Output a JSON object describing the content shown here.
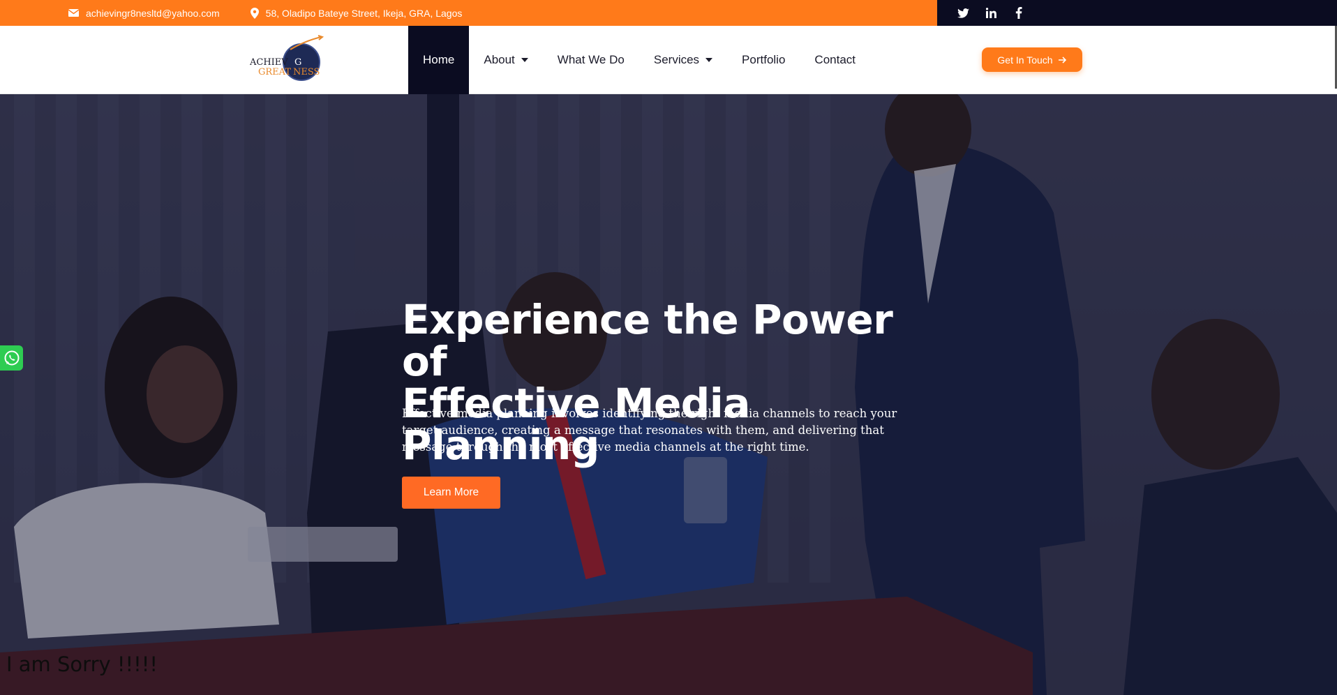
{
  "topbar": {
    "email": "achievingr8nesltd@yahoo.com",
    "address": "58, Oladipo Bateye Street, Ikeja, GRA, Lagos",
    "social": [
      "twitter-icon",
      "linkedin-icon",
      "facebook-icon"
    ]
  },
  "header": {
    "logo": {
      "line1": "ACHIEV",
      "line1b": "G",
      "line2": "GREAT",
      "line2b": "NESS"
    },
    "nav": [
      {
        "label": "Home",
        "active": true,
        "dropdown": false
      },
      {
        "label": "About",
        "active": false,
        "dropdown": true
      },
      {
        "label": "What We Do",
        "active": false,
        "dropdown": false
      },
      {
        "label": "Services",
        "active": false,
        "dropdown": true
      },
      {
        "label": "Portfolio",
        "active": false,
        "dropdown": false
      },
      {
        "label": "Contact",
        "active": false,
        "dropdown": false
      }
    ],
    "cta_label": "Get In Touch"
  },
  "hero": {
    "title_line1": "Experience the Power of",
    "title_line2": "Effective Media Planning",
    "text": "Effective media planning involves identifying the right media channels to reach your target audience, creating a message that resonates with them, and delivering that message through the most effective media channels at the right time.",
    "button_label": "Learn More"
  },
  "footer_note": "I am Sorry !!!!!",
  "colors": {
    "accent": "#ff7a1a",
    "dark": "#0b0c21",
    "whatsapp": "#2ecc52"
  }
}
